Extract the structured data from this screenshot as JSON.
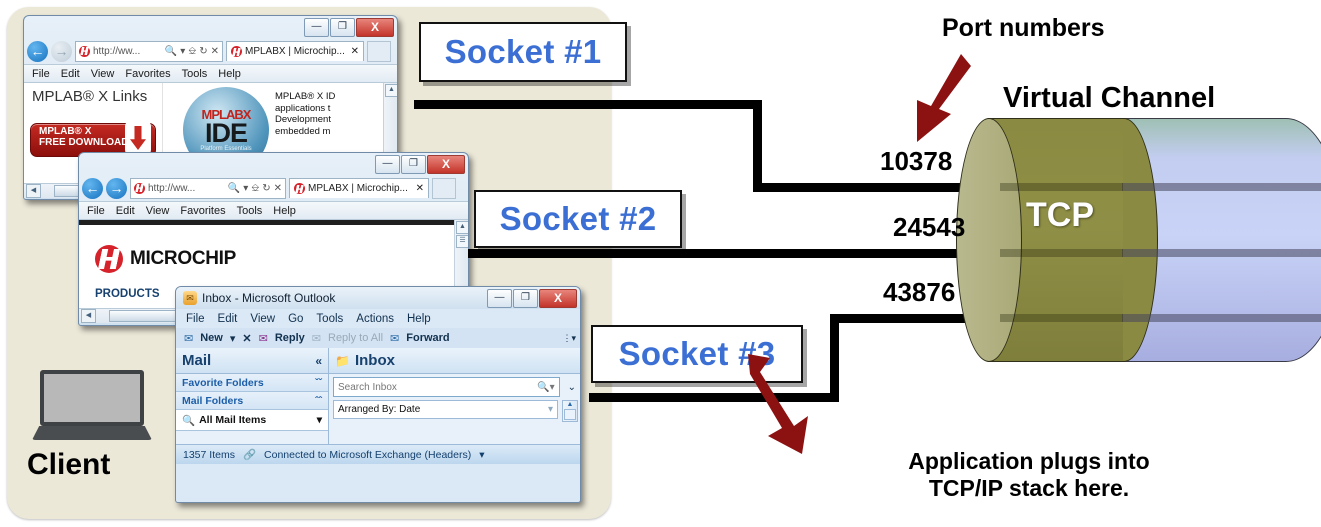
{
  "diagram": {
    "title_port_numbers": "Port numbers",
    "title_virtual_channel": "Virtual Channel",
    "tcp_label": "TCP",
    "client_label": "Client",
    "note_line1": "Application plugs into",
    "note_line2": "TCP/IP stack here.",
    "accent_arrow_color": "#8c1212",
    "socket_text_color": "#3b6fd4",
    "tcp_cylinder_color": "#8a8a42",
    "channel_cylinder_color": "#c3cdf0",
    "panel_color": "#ece8d8"
  },
  "sockets": [
    {
      "label": "Socket #1",
      "port": "10378"
    },
    {
      "label": "Socket #2",
      "port": "24543"
    },
    {
      "label": "Socket #3",
      "port": "43876"
    }
  ],
  "browser1": {
    "address_text": "http://ww...",
    "tab_title": "MPLABX | Microchip...",
    "menu": [
      "File",
      "Edit",
      "View",
      "Favorites",
      "Tools",
      "Help"
    ],
    "heading": "MPLAB® X Links",
    "download_line1": "MPLAB® X",
    "download_line2": "FREE DOWNLOAD",
    "logo_top": "MPLABX",
    "logo_mid": "IDE",
    "logo_sub": "Platform Essentials",
    "body_lines": [
      "MPLAB® X ID",
      "applications t",
      "Development",
      "embedded m"
    ],
    "win_min": "—",
    "win_max": "❐",
    "win_close": "X"
  },
  "browser2": {
    "address_text": "http://ww...",
    "tab_title": "MPLABX | Microchip...",
    "menu": [
      "File",
      "Edit",
      "View",
      "Favorites",
      "Tools",
      "Help"
    ],
    "brand": "MICROCHIP",
    "nav_item": "PRODUCTS",
    "win_min": "—",
    "win_max": "❐",
    "win_close": "X"
  },
  "outlook": {
    "title": "Inbox - Microsoft Outlook",
    "menu": [
      "File",
      "Edit",
      "View",
      "Go",
      "Tools",
      "Actions",
      "Help"
    ],
    "toolbar": {
      "new": "New",
      "new_caret": "▾",
      "delete": "✕",
      "reply": "Reply",
      "reply_all": "Reply to All",
      "forward": "Forward"
    },
    "left_header": "Mail",
    "left_collapse": "«",
    "left_rows": [
      {
        "label": "Favorite Folders",
        "chevron": "ˇˇ"
      },
      {
        "label": "Mail Folders",
        "chevron": "ˆˆ"
      }
    ],
    "all_mail_items": "All Mail Items",
    "all_mail_caret": "▾",
    "right_header": "Inbox",
    "search_placeholder": "Search Inbox",
    "arranged_by": "Arranged By: Date",
    "status_items": "1357 Items",
    "status_connection": "Connected to Microsoft Exchange (Headers)",
    "win_min": "—",
    "win_max": "❐",
    "win_close": "X"
  }
}
